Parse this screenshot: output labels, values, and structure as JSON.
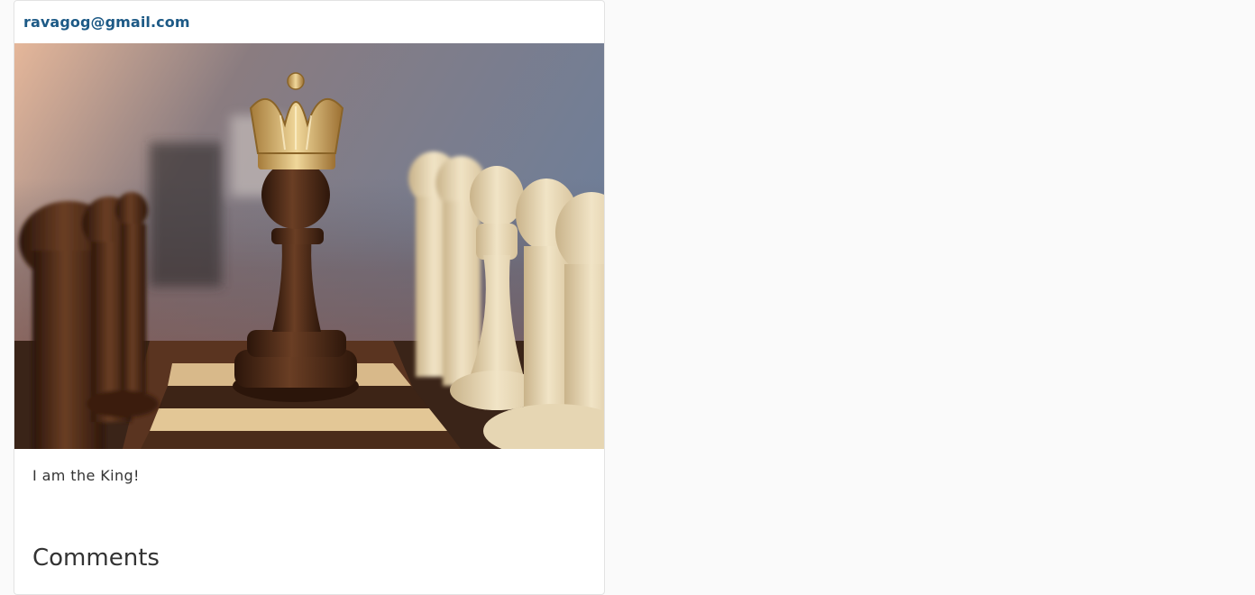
{
  "post": {
    "author_email": "ravagog@gmail.com",
    "caption": "I am the King!"
  },
  "comments": {
    "heading": "Comments"
  },
  "image": {
    "subject": "chess-crowned-pawn-photo",
    "colors": {
      "bg_top_left": "#e5b79a",
      "bg_top_right": "#6f7e98",
      "dark_piece": "#4a2a18",
      "light_piece": "#e6d6b3",
      "crown": "#c9a25a"
    }
  },
  "theme": {
    "accent": "#1d5a86",
    "page_bg": "#fafafa",
    "card_bg": "#ffffff",
    "text": "#333333"
  }
}
